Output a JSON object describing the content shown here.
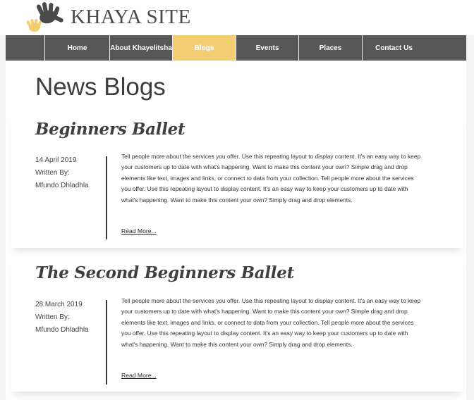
{
  "site": {
    "title": "KHAYA SITE",
    "logo_icon": "hand-icon",
    "colors": {
      "nav_bg": "#575757",
      "active_tab": "#f3cd71",
      "logo_dark": "#4a4a4a",
      "logo_accent": "#f3cd71"
    }
  },
  "nav": {
    "items": [
      {
        "label": "Home",
        "active": false
      },
      {
        "label": "About Khayelitsha",
        "active": false
      },
      {
        "label": "Blogs",
        "active": true
      },
      {
        "label": "Events",
        "active": false
      },
      {
        "label": "Places",
        "active": false
      },
      {
        "label": "Contact Us",
        "active": false
      }
    ]
  },
  "page": {
    "title": "News Blogs"
  },
  "posts": [
    {
      "title": "Beginners Ballet",
      "date": "14 April 2019",
      "written_by_label": "Written By:",
      "author": "Mfundo Dhladhla",
      "excerpt": "Tell people more about the services you offer. Use this repeating layout to display content. It's an easy way to keep your customers up to date with what's happening. Want to make this content your own? Simple drag and drop elements like text, images and links, or connect to data from your collection. Tell people more about the services you offer. Use this repeating layout to display content. It's an easy way to keep your customers up to date with what's happening. Want to make this content your own? Simply drag and drop elements.",
      "read_more": "Read More..."
    },
    {
      "title": "The Second Beginners Ballet",
      "date": "28 March 2019",
      "written_by_label": "Written By:",
      "author": "Mfundo Dhladhla",
      "excerpt": "Tell people more about the services you offer. Use this repeating layout to display content. It's an easy way to keep your customers up to date with what's happening. Want to make this content your own? Simple drag and drop elements like text, images and links, or connect to data from your collection. Tell people more about the services you offer. Use this repeating layout to display content. It's an easy way to keep your customers up to date with what's happening. Want to make this content your own? Simply drag and drop elements.",
      "read_more": "Read More..."
    }
  ]
}
